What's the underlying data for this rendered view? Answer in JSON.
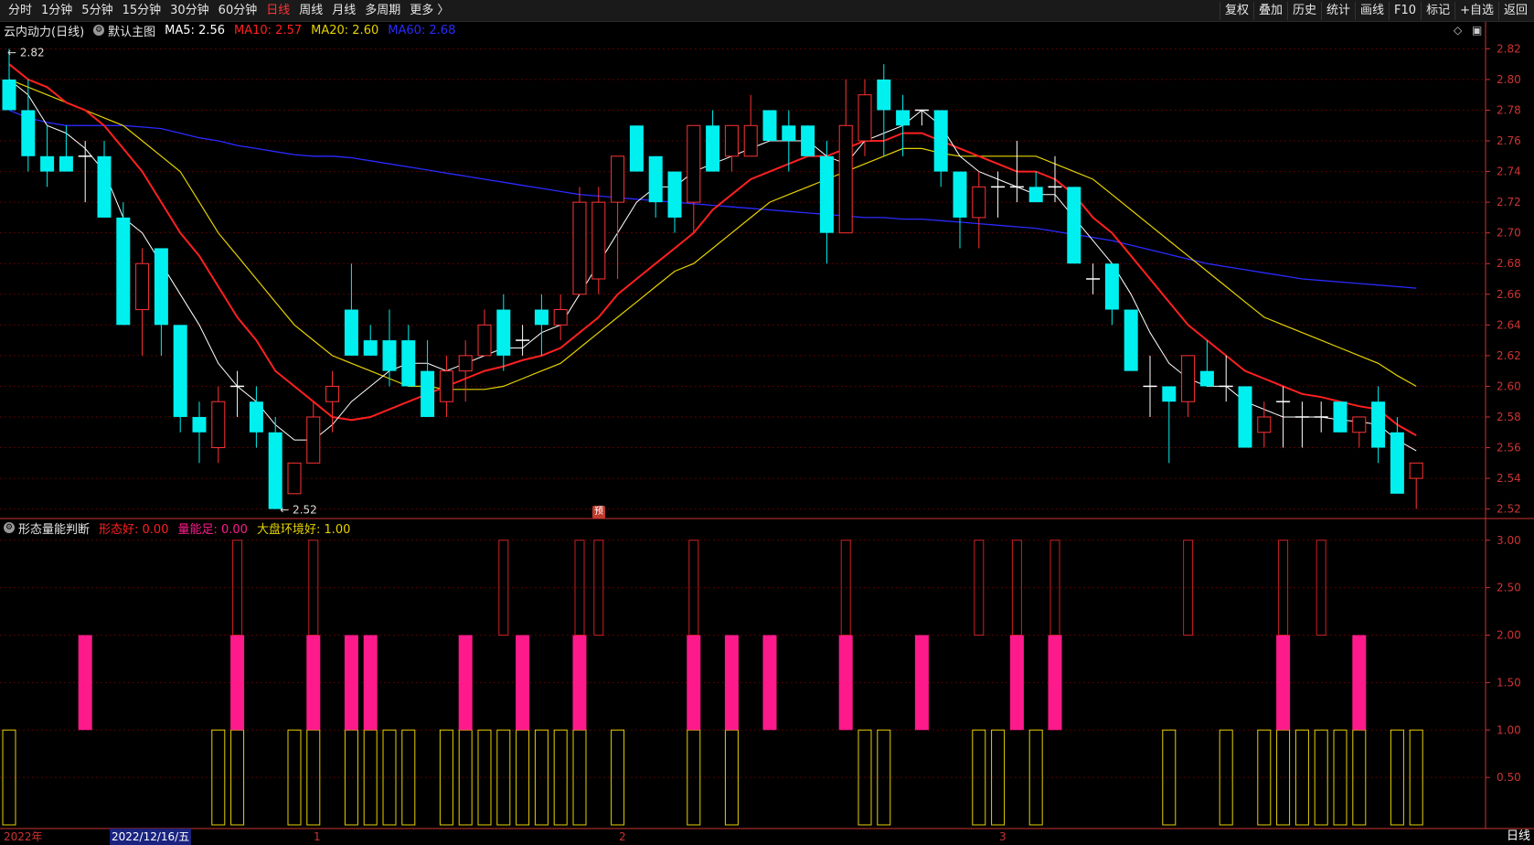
{
  "toolbar": {
    "left_items": [
      "分时",
      "1分钟",
      "5分钟",
      "15分钟",
      "30分钟",
      "60分钟",
      "日线",
      "周线",
      "月线",
      "多周期",
      "更多 〉"
    ],
    "active_index": 6,
    "right_items": [
      "复权",
      "叠加",
      "历史",
      "统计",
      "画线",
      "F10",
      "标记",
      "+自选",
      "返回"
    ]
  },
  "main_legend": {
    "name": "云内动力(日线)",
    "template": "默认主图",
    "ma5": "MA5: 2.56",
    "ma10": "MA10: 2.57",
    "ma20": "MA20: 2.60",
    "ma60": "MA60: 2.68"
  },
  "sub_legend": {
    "name": "形态量能判断",
    "xtaihao": "形态好: 0.00",
    "liangneng": "量能足: 0.00",
    "dapan": "大盘环境好: 1.00"
  },
  "annotations": {
    "high": "2.82",
    "low": "2.52",
    "pre": "预"
  },
  "price_axis": [
    "2.82",
    "2.80",
    "2.78",
    "2.76",
    "2.74",
    "2.72",
    "2.70",
    "2.68",
    "2.66",
    "2.64",
    "2.62",
    "2.60",
    "2.58",
    "2.56",
    "2.54",
    "2.52"
  ],
  "ind_axis": [
    "3.00",
    "2.50",
    "2.00",
    "1.50",
    "1.00",
    "0.50"
  ],
  "bottom": {
    "year": "2022年",
    "selected_date": "2022/12/16/五",
    "m1": "1",
    "m2": "2",
    "m3": "3",
    "period": "日线"
  },
  "colors": {
    "up": "#ff3333",
    "down": "#00f0f0",
    "ma5": "#ffffff",
    "ma10": "#ff2020",
    "ma20": "#e6d200",
    "ma60": "#2a2aff",
    "pink": "#ff1a8c",
    "yellow": "#e6d200",
    "grid": "#5a0000",
    "axis": "#cc3333"
  },
  "chart_data": {
    "type": "candlestick",
    "price_range": [
      2.515,
      2.825
    ],
    "indicator_range": [
      0,
      3.2
    ],
    "candles": [
      {
        "o": 2.8,
        "h": 2.82,
        "l": 2.78,
        "c": 2.78
      },
      {
        "o": 2.78,
        "h": 2.8,
        "l": 2.74,
        "c": 2.75
      },
      {
        "o": 2.75,
        "h": 2.77,
        "l": 2.73,
        "c": 2.74
      },
      {
        "o": 2.75,
        "h": 2.77,
        "l": 2.74,
        "c": 2.74
      },
      {
        "o": 2.75,
        "h": 2.76,
        "l": 2.72,
        "c": 2.75
      },
      {
        "o": 2.75,
        "h": 2.76,
        "l": 2.71,
        "c": 2.71
      },
      {
        "o": 2.71,
        "h": 2.72,
        "l": 2.64,
        "c": 2.64
      },
      {
        "o": 2.65,
        "h": 2.69,
        "l": 2.62,
        "c": 2.68
      },
      {
        "o": 2.69,
        "h": 2.69,
        "l": 2.62,
        "c": 2.64
      },
      {
        "o": 2.64,
        "h": 2.64,
        "l": 2.57,
        "c": 2.58
      },
      {
        "o": 2.58,
        "h": 2.59,
        "l": 2.55,
        "c": 2.57
      },
      {
        "o": 2.56,
        "h": 2.6,
        "l": 2.55,
        "c": 2.59
      },
      {
        "o": 2.6,
        "h": 2.61,
        "l": 2.58,
        "c": 2.6
      },
      {
        "o": 2.59,
        "h": 2.6,
        "l": 2.56,
        "c": 2.57
      },
      {
        "o": 2.57,
        "h": 2.58,
        "l": 2.52,
        "c": 2.52
      },
      {
        "o": 2.53,
        "h": 2.55,
        "l": 2.53,
        "c": 2.55
      },
      {
        "o": 2.55,
        "h": 2.59,
        "l": 2.55,
        "c": 2.58
      },
      {
        "o": 2.59,
        "h": 2.61,
        "l": 2.57,
        "c": 2.6
      },
      {
        "o": 2.65,
        "h": 2.68,
        "l": 2.62,
        "c": 2.62
      },
      {
        "o": 2.63,
        "h": 2.64,
        "l": 2.62,
        "c": 2.62
      },
      {
        "o": 2.63,
        "h": 2.65,
        "l": 2.6,
        "c": 2.61
      },
      {
        "o": 2.63,
        "h": 2.64,
        "l": 2.6,
        "c": 2.6
      },
      {
        "o": 2.61,
        "h": 2.63,
        "l": 2.58,
        "c": 2.58
      },
      {
        "o": 2.59,
        "h": 2.62,
        "l": 2.58,
        "c": 2.61
      },
      {
        "o": 2.61,
        "h": 2.63,
        "l": 2.59,
        "c": 2.62
      },
      {
        "o": 2.62,
        "h": 2.65,
        "l": 2.62,
        "c": 2.64
      },
      {
        "o": 2.65,
        "h": 2.66,
        "l": 2.61,
        "c": 2.62
      },
      {
        "o": 2.63,
        "h": 2.64,
        "l": 2.62,
        "c": 2.63
      },
      {
        "o": 2.65,
        "h": 2.66,
        "l": 2.62,
        "c": 2.64
      },
      {
        "o": 2.64,
        "h": 2.66,
        "l": 2.63,
        "c": 2.65
      },
      {
        "o": 2.66,
        "h": 2.73,
        "l": 2.66,
        "c": 2.72
      },
      {
        "o": 2.67,
        "h": 2.73,
        "l": 2.66,
        "c": 2.72
      },
      {
        "o": 2.72,
        "h": 2.75,
        "l": 2.67,
        "c": 2.75
      },
      {
        "o": 2.77,
        "h": 2.77,
        "l": 2.74,
        "c": 2.74
      },
      {
        "o": 2.75,
        "h": 2.75,
        "l": 2.71,
        "c": 2.72
      },
      {
        "o": 2.74,
        "h": 2.74,
        "l": 2.7,
        "c": 2.71
      },
      {
        "o": 2.72,
        "h": 2.77,
        "l": 2.7,
        "c": 2.77
      },
      {
        "o": 2.77,
        "h": 2.78,
        "l": 2.74,
        "c": 2.74
      },
      {
        "o": 2.75,
        "h": 2.77,
        "l": 2.74,
        "c": 2.77
      },
      {
        "o": 2.75,
        "h": 2.79,
        "l": 2.75,
        "c": 2.77
      },
      {
        "o": 2.78,
        "h": 2.78,
        "l": 2.76,
        "c": 2.76
      },
      {
        "o": 2.77,
        "h": 2.78,
        "l": 2.74,
        "c": 2.76
      },
      {
        "o": 2.77,
        "h": 2.77,
        "l": 2.75,
        "c": 2.75
      },
      {
        "o": 2.75,
        "h": 2.76,
        "l": 2.68,
        "c": 2.7
      },
      {
        "o": 2.7,
        "h": 2.8,
        "l": 2.7,
        "c": 2.77
      },
      {
        "o": 2.76,
        "h": 2.8,
        "l": 2.75,
        "c": 2.79
      },
      {
        "o": 2.8,
        "h": 2.81,
        "l": 2.75,
        "c": 2.78
      },
      {
        "o": 2.78,
        "h": 2.79,
        "l": 2.75,
        "c": 2.77
      },
      {
        "o": 2.78,
        "h": 2.78,
        "l": 2.77,
        "c": 2.78
      },
      {
        "o": 2.78,
        "h": 2.78,
        "l": 2.73,
        "c": 2.74
      },
      {
        "o": 2.74,
        "h": 2.74,
        "l": 2.69,
        "c": 2.71
      },
      {
        "o": 2.71,
        "h": 2.74,
        "l": 2.69,
        "c": 2.73
      },
      {
        "o": 2.73,
        "h": 2.74,
        "l": 2.71,
        "c": 2.73
      },
      {
        "o": 2.73,
        "h": 2.76,
        "l": 2.72,
        "c": 2.73
      },
      {
        "o": 2.73,
        "h": 2.74,
        "l": 2.72,
        "c": 2.72
      },
      {
        "o": 2.73,
        "h": 2.75,
        "l": 2.72,
        "c": 2.73
      },
      {
        "o": 2.73,
        "h": 2.73,
        "l": 2.68,
        "c": 2.68
      },
      {
        "o": 2.67,
        "h": 2.68,
        "l": 2.66,
        "c": 2.67
      },
      {
        "o": 2.68,
        "h": 2.68,
        "l": 2.64,
        "c": 2.65
      },
      {
        "o": 2.65,
        "h": 2.65,
        "l": 2.61,
        "c": 2.61
      },
      {
        "o": 2.6,
        "h": 2.62,
        "l": 2.58,
        "c": 2.6
      },
      {
        "o": 2.6,
        "h": 2.6,
        "l": 2.55,
        "c": 2.59
      },
      {
        "o": 2.59,
        "h": 2.62,
        "l": 2.58,
        "c": 2.62
      },
      {
        "o": 2.61,
        "h": 2.63,
        "l": 2.6,
        "c": 2.6
      },
      {
        "o": 2.6,
        "h": 2.62,
        "l": 2.59,
        "c": 2.6
      },
      {
        "o": 2.6,
        "h": 2.6,
        "l": 2.56,
        "c": 2.56
      },
      {
        "o": 2.57,
        "h": 2.59,
        "l": 2.56,
        "c": 2.58
      },
      {
        "o": 2.59,
        "h": 2.6,
        "l": 2.56,
        "c": 2.59
      },
      {
        "o": 2.58,
        "h": 2.59,
        "l": 2.56,
        "c": 2.58
      },
      {
        "o": 2.58,
        "h": 2.59,
        "l": 2.57,
        "c": 2.58
      },
      {
        "o": 2.59,
        "h": 2.59,
        "l": 2.57,
        "c": 2.57
      },
      {
        "o": 2.57,
        "h": 2.58,
        "l": 2.56,
        "c": 2.58
      },
      {
        "o": 2.59,
        "h": 2.6,
        "l": 2.55,
        "c": 2.56
      },
      {
        "o": 2.57,
        "h": 2.58,
        "l": 2.54,
        "c": 2.53
      },
      {
        "o": 2.54,
        "h": 2.55,
        "l": 2.52,
        "c": 2.55
      }
    ],
    "ma5": [
      2.8,
      2.79,
      2.77,
      2.765,
      2.755,
      2.74,
      2.71,
      2.7,
      2.68,
      2.66,
      2.64,
      2.615,
      2.6,
      2.59,
      2.575,
      2.565,
      2.565,
      2.575,
      2.59,
      2.6,
      2.61,
      2.615,
      2.615,
      2.61,
      2.615,
      2.62,
      2.625,
      2.625,
      2.635,
      2.64,
      2.66,
      2.68,
      2.7,
      2.72,
      2.73,
      2.73,
      2.74,
      2.745,
      2.75,
      2.755,
      2.76,
      2.76,
      2.76,
      2.75,
      2.745,
      2.76,
      2.765,
      2.77,
      2.78,
      2.77,
      2.75,
      2.74,
      2.735,
      2.73,
      2.725,
      2.725,
      2.71,
      2.695,
      2.68,
      2.66,
      2.635,
      2.615,
      2.605,
      2.6,
      2.6,
      2.59,
      2.585,
      2.58,
      2.58,
      2.58,
      2.578,
      2.577,
      2.575,
      2.565,
      2.558
    ],
    "ma10": [
      2.81,
      2.8,
      2.795,
      2.785,
      2.78,
      2.77,
      2.755,
      2.74,
      2.72,
      2.7,
      2.685,
      2.665,
      2.645,
      2.63,
      2.61,
      2.6,
      2.59,
      2.58,
      2.578,
      2.58,
      2.585,
      2.59,
      2.595,
      2.6,
      2.605,
      2.61,
      2.613,
      2.617,
      2.62,
      2.625,
      2.635,
      2.645,
      2.66,
      2.67,
      2.68,
      2.69,
      2.7,
      2.715,
      2.725,
      2.735,
      2.74,
      2.745,
      2.75,
      2.75,
      2.755,
      2.76,
      2.76,
      2.765,
      2.765,
      2.76,
      2.755,
      2.75,
      2.745,
      2.74,
      2.74,
      2.735,
      2.725,
      2.71,
      2.7,
      2.685,
      2.67,
      2.655,
      2.64,
      2.63,
      2.62,
      2.61,
      2.605,
      2.6,
      2.595,
      2.593,
      2.59,
      2.587,
      2.585,
      2.575,
      2.568
    ],
    "ma20": [
      2.8,
      2.795,
      2.79,
      2.785,
      2.78,
      2.775,
      2.77,
      2.76,
      2.75,
      2.74,
      2.72,
      2.7,
      2.685,
      2.67,
      2.655,
      2.64,
      2.63,
      2.62,
      2.615,
      2.61,
      2.605,
      2.6,
      2.6,
      2.598,
      2.598,
      2.598,
      2.6,
      2.605,
      2.61,
      2.615,
      2.625,
      2.635,
      2.645,
      2.655,
      2.665,
      2.675,
      2.68,
      2.69,
      2.7,
      2.71,
      2.72,
      2.725,
      2.73,
      2.735,
      2.74,
      2.745,
      2.75,
      2.755,
      2.755,
      2.752,
      2.75,
      2.75,
      2.75,
      2.75,
      2.75,
      2.745,
      2.74,
      2.735,
      2.725,
      2.715,
      2.705,
      2.695,
      2.685,
      2.675,
      2.665,
      2.655,
      2.645,
      2.64,
      2.635,
      2.63,
      2.625,
      2.62,
      2.615,
      2.607,
      2.6
    ],
    "ma60": [
      2.78,
      2.775,
      2.772,
      2.77,
      2.77,
      2.77,
      2.77,
      2.769,
      2.768,
      2.765,
      2.762,
      2.76,
      2.757,
      2.755,
      2.753,
      2.751,
      2.75,
      2.75,
      2.749,
      2.747,
      2.745,
      2.743,
      2.741,
      2.739,
      2.737,
      2.735,
      2.733,
      2.731,
      2.729,
      2.727,
      2.725,
      2.724,
      2.723,
      2.722,
      2.721,
      2.72,
      2.719,
      2.718,
      2.717,
      2.716,
      2.715,
      2.714,
      2.713,
      2.712,
      2.711,
      2.71,
      2.71,
      2.709,
      2.709,
      2.708,
      2.707,
      2.706,
      2.705,
      2.704,
      2.703,
      2.701,
      2.699,
      2.697,
      2.695,
      2.692,
      2.689,
      2.686,
      2.683,
      2.68,
      2.678,
      2.676,
      2.674,
      2.672,
      2.67,
      2.669,
      2.668,
      2.667,
      2.666,
      2.665,
      2.664
    ],
    "xtaihao": [
      0,
      0,
      0,
      0,
      0,
      0,
      0,
      0,
      0,
      0,
      0,
      0,
      1,
      0,
      0,
      0,
      1,
      0,
      0,
      0,
      0,
      0,
      0,
      0,
      0,
      0,
      1,
      0,
      0,
      0,
      1,
      1,
      0,
      0,
      0,
      0,
      1,
      0,
      0,
      0,
      0,
      0,
      0,
      0,
      1,
      0,
      0,
      0,
      0,
      0,
      0,
      1,
      0,
      1,
      0,
      1,
      0,
      0,
      0,
      0,
      0,
      0,
      1,
      0,
      0,
      0,
      0,
      1,
      0,
      1,
      0,
      0,
      0,
      0,
      0
    ],
    "liangneng": [
      0,
      0,
      0,
      0,
      1,
      0,
      0,
      0,
      0,
      0,
      0,
      0,
      1,
      0,
      0,
      0,
      1,
      0,
      1,
      1,
      0,
      0,
      0,
      0,
      1,
      0,
      0,
      1,
      0,
      0,
      1,
      0,
      0,
      0,
      0,
      0,
      1,
      0,
      1,
      0,
      1,
      0,
      0,
      0,
      1,
      0,
      0,
      0,
      1,
      0,
      0,
      0,
      0,
      1,
      0,
      1,
      0,
      0,
      0,
      0,
      0,
      0,
      0,
      0,
      0,
      0,
      0,
      1,
      0,
      0,
      0,
      1,
      0,
      0,
      0
    ],
    "dapan": [
      1,
      0,
      0,
      0,
      0,
      0,
      0,
      0,
      0,
      0,
      0,
      1,
      1,
      0,
      0,
      1,
      1,
      0,
      1,
      1,
      1,
      1,
      0,
      1,
      1,
      1,
      1,
      1,
      1,
      1,
      1,
      0,
      1,
      0,
      0,
      0,
      1,
      0,
      1,
      0,
      0,
      0,
      0,
      0,
      0,
      1,
      1,
      0,
      0,
      0,
      0,
      1,
      1,
      0,
      1,
      0,
      0,
      0,
      0,
      0,
      0,
      1,
      0,
      0,
      1,
      0,
      1,
      1,
      1,
      1,
      1,
      1,
      0,
      1,
      1
    ]
  }
}
